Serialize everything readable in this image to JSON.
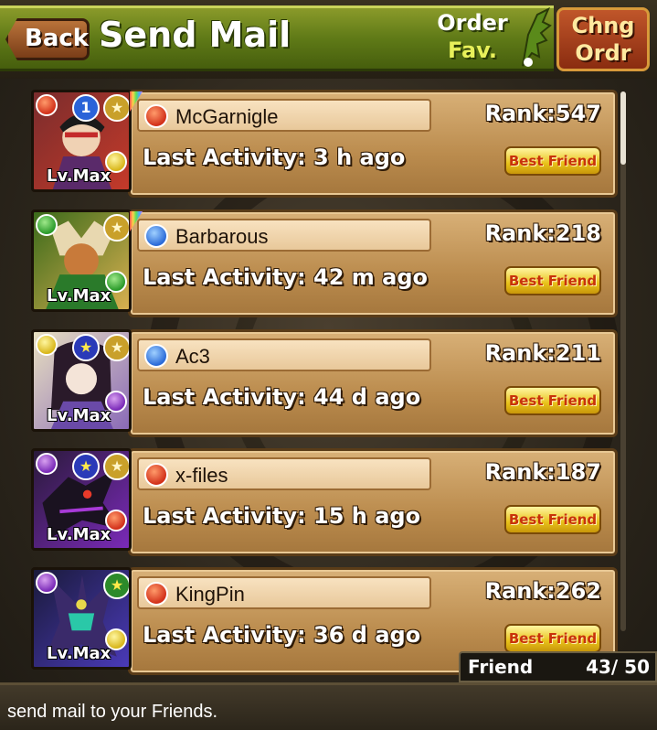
{
  "header": {
    "back_label": "Back",
    "title": "Send Mail",
    "order_line1": "Order",
    "order_line2": "Fav.",
    "chng_line1": "Chng",
    "chng_line2": "Ordr"
  },
  "friends": [
    {
      "name": "McGarnigle",
      "rank": "Rank:547",
      "activity": "Last Activity: 3 h ago",
      "badge": "Best Friend",
      "level": "Lv.Max",
      "element": "fire",
      "slot_badge": "1",
      "colors": {
        "a": "#7a2c2c",
        "b": "#c43a2a"
      }
    },
    {
      "name": "Barbarous",
      "rank": "Rank:218",
      "activity": "Last Activity: 42 m ago",
      "badge": "Best Friend",
      "level": "Lv.Max",
      "element": "water",
      "colors": {
        "a": "#6a7a2c",
        "b": "#c8a04a"
      }
    },
    {
      "name": "Ac3",
      "rank": "Rank:211",
      "activity": "Last Activity: 44 d ago",
      "badge": "Best Friend",
      "level": "Lv.Max",
      "element": "water",
      "colors": {
        "a": "#7a6a3a",
        "b": "#e0d8c8"
      }
    },
    {
      "name": "x-files",
      "rank": "Rank:187",
      "activity": "Last Activity: 15 h ago",
      "badge": "Best Friend",
      "level": "Lv.Max",
      "element": "fire",
      "colors": {
        "a": "#3a1a4a",
        "b": "#8a3ab8"
      }
    },
    {
      "name": "KingPin",
      "rank": "Rank:262",
      "activity": "Last Activity: 36 d ago",
      "badge": "Best Friend",
      "level": "Lv.Max",
      "element": "fire",
      "colors": {
        "a": "#2a1a3a",
        "b": "#6a3ac8"
      }
    }
  ],
  "friend_count": {
    "label": "Friend",
    "value": "43/ 50"
  },
  "footer": {
    "text": "send mail to your Friends."
  }
}
